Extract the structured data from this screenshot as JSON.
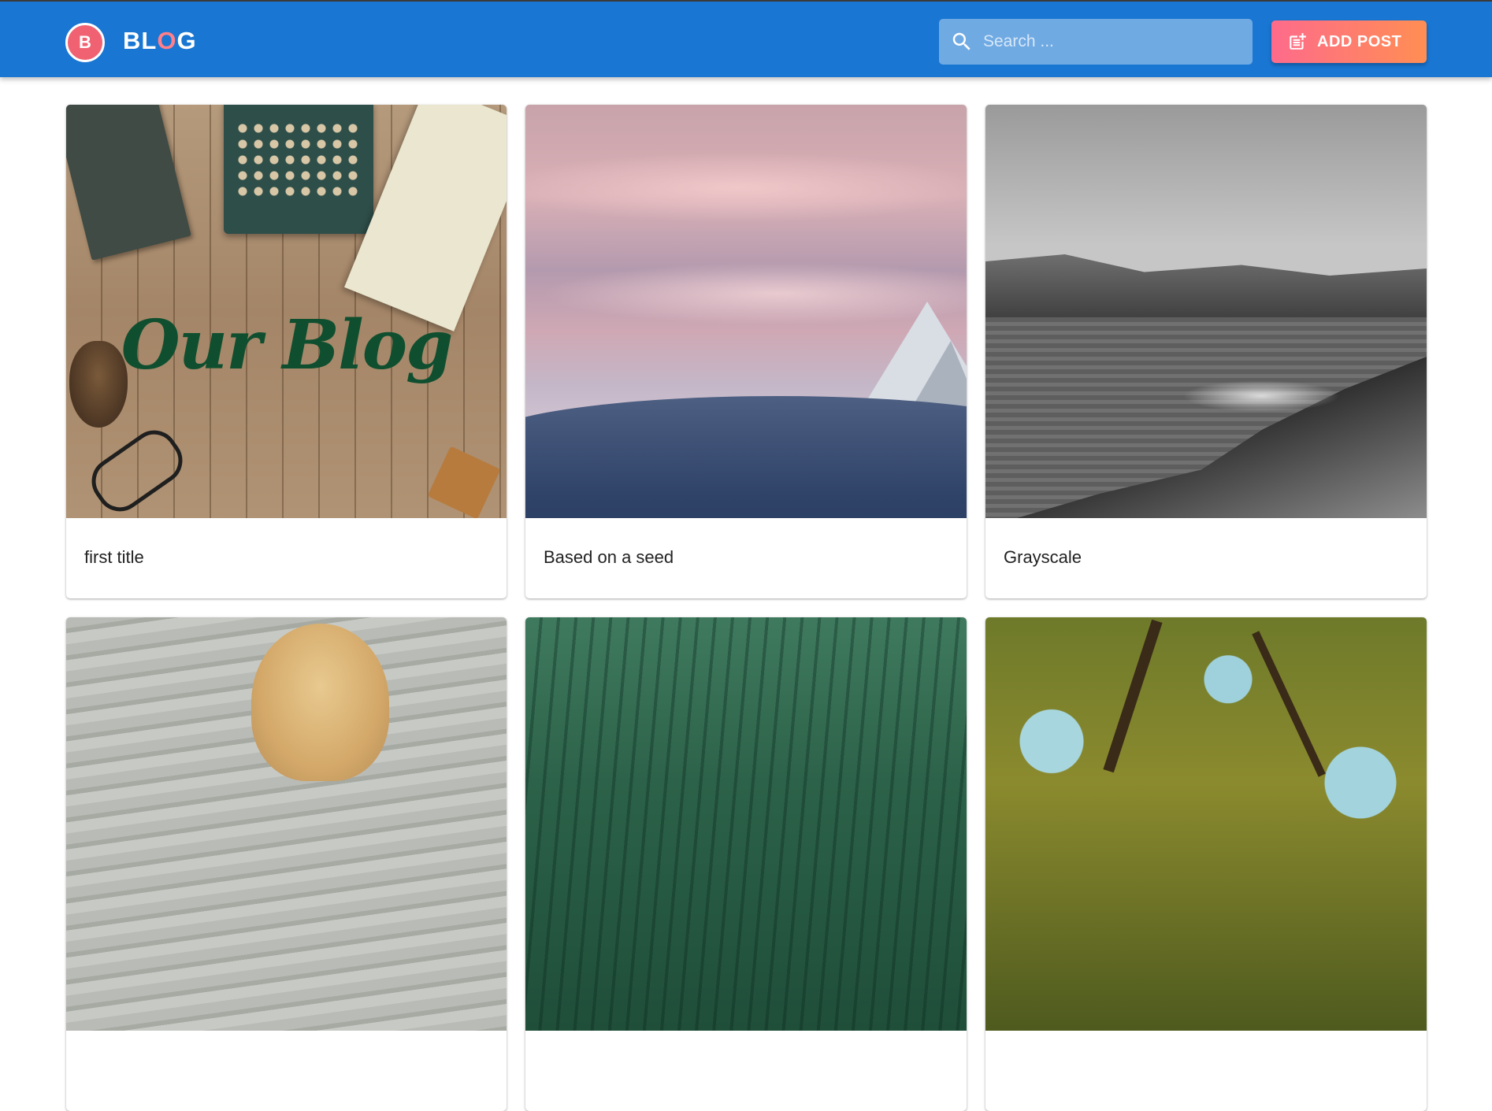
{
  "header": {
    "logo_initial": "B",
    "logo_text_part1": "BL",
    "logo_text_accent": "O",
    "logo_text_part2": "G",
    "search_placeholder": "Search ...",
    "search_icon": "search-icon",
    "add_post_label": "ADD POST",
    "add_post_icon": "post-add-icon"
  },
  "colors": {
    "appbar": "#1976d2",
    "avatar": "#f06272",
    "button_gradient_start": "#fe6b8b",
    "button_gradient_end": "#ff8e53"
  },
  "posts": [
    {
      "title": "first title",
      "image_text": "Our Blog"
    },
    {
      "title": "Based on a seed"
    },
    {
      "title": "Grayscale"
    },
    {
      "title": ""
    },
    {
      "title": ""
    },
    {
      "title": ""
    }
  ]
}
